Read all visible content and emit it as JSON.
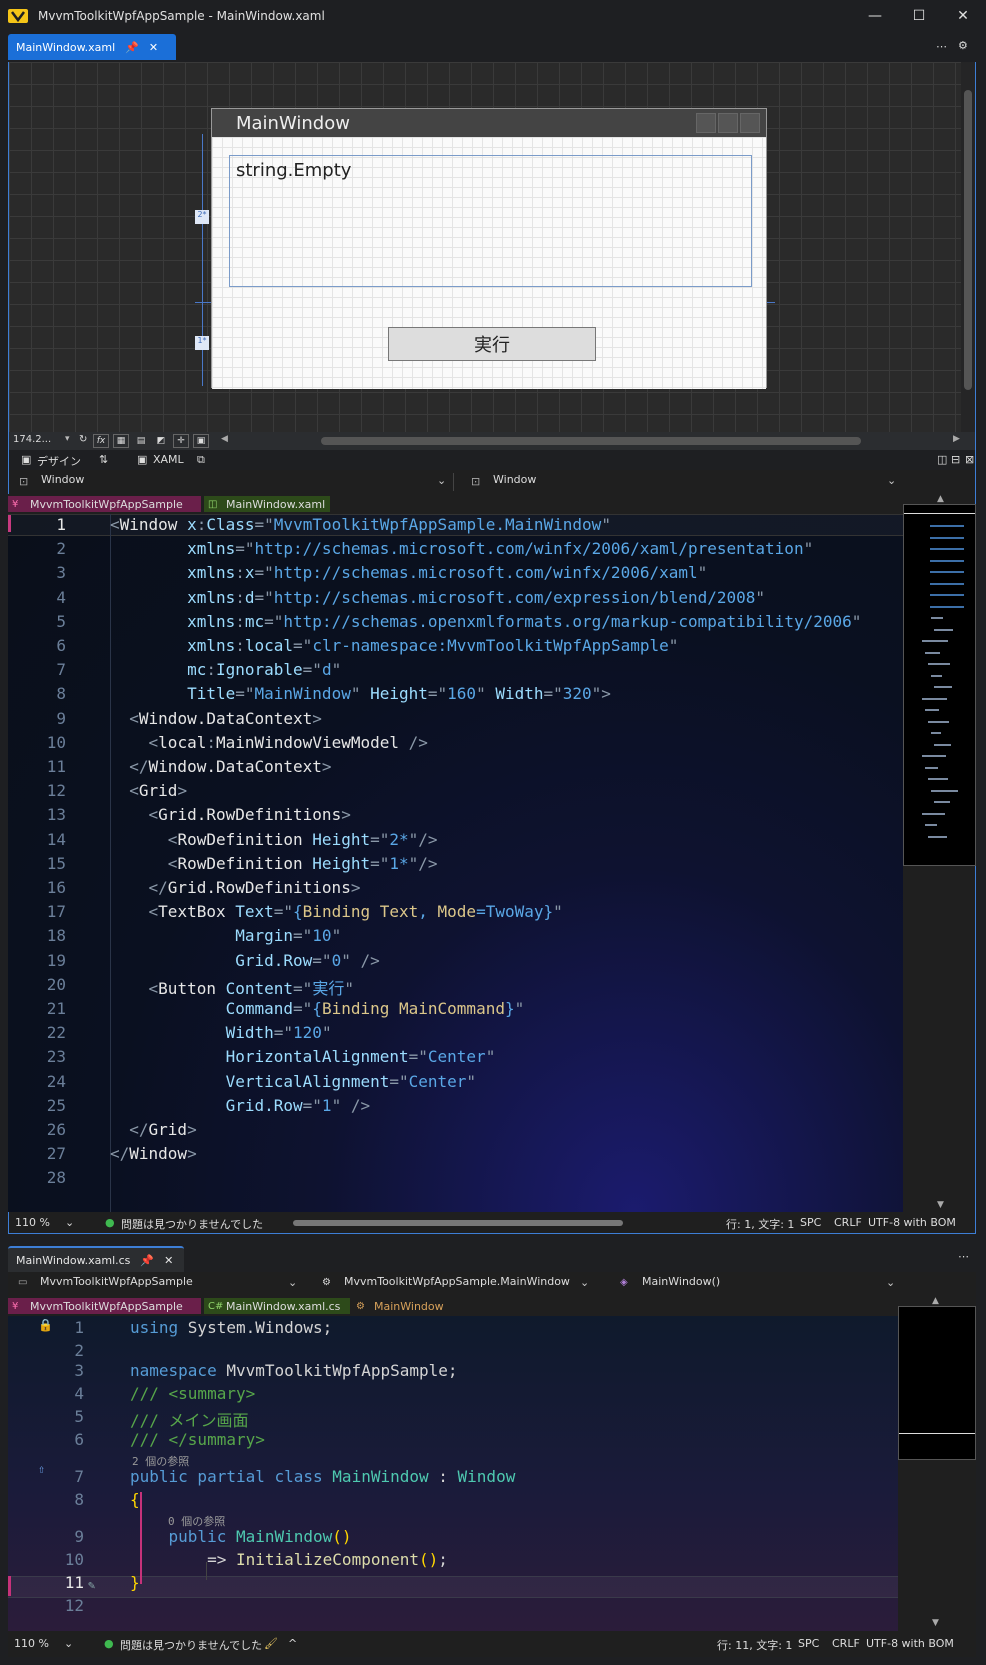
{
  "window": {
    "title": "MvvmToolkitWpfAppSample - MainWindow.xaml",
    "minimize": "—",
    "maximize": "☐",
    "close": "✕"
  },
  "tab1": {
    "label": "MainWindow.xaml",
    "pin": "📌",
    "close": "✕"
  },
  "topright": {
    "overflow": "⋯",
    "settings": "⚙"
  },
  "designer": {
    "window_title": "MainWindow",
    "textbox_text": "string.Empty",
    "button_text": "実行",
    "row_marker_1": "2*",
    "row_marker_2": "1*",
    "zoom": "174.2...",
    "fx": "fx"
  },
  "splitbar": {
    "design_label": "デザイン",
    "swap": "⇅",
    "xaml_label": "XAML"
  },
  "xaml_nav": {
    "left": "Window",
    "right": "Window"
  },
  "xaml_crumbs": {
    "project": "MvvmToolkitWpfAppSample",
    "file": "MainWindow.xaml"
  },
  "xaml_lines": [
    "1",
    "2",
    "3",
    "4",
    "5",
    "6",
    "7",
    "8",
    "9",
    "10",
    "11",
    "12",
    "13",
    "14",
    "15",
    "16",
    "17",
    "18",
    "19",
    "20",
    "21",
    "22",
    "23",
    "24",
    "25",
    "26",
    "27",
    "28"
  ],
  "xaml_code": [
    [
      [
        "t-b",
        "<"
      ],
      [
        "t-tag",
        "Window "
      ],
      [
        "t-attr",
        "x"
      ],
      [
        "t-b",
        ":"
      ],
      [
        "t-attr",
        "Class"
      ],
      [
        "t-b",
        "=\""
      ],
      [
        "t-str",
        "MvvmToolkitWpfAppSample.MainWindow"
      ],
      [
        "t-b",
        "\""
      ]
    ],
    [
      [
        "t-b",
        "        "
      ],
      [
        "t-attr",
        "xmlns"
      ],
      [
        "t-b",
        "=\""
      ],
      [
        "t-str",
        "http://schemas.microsoft.com/winfx/2006/xaml/presentation"
      ],
      [
        "t-b",
        "\""
      ]
    ],
    [
      [
        "t-b",
        "        "
      ],
      [
        "t-attr",
        "xmlns"
      ],
      [
        "t-b",
        ":"
      ],
      [
        "t-attr",
        "x"
      ],
      [
        "t-b",
        "=\""
      ],
      [
        "t-str",
        "http://schemas.microsoft.com/winfx/2006/xaml"
      ],
      [
        "t-b",
        "\""
      ]
    ],
    [
      [
        "t-b",
        "        "
      ],
      [
        "t-attr",
        "xmlns"
      ],
      [
        "t-b",
        ":"
      ],
      [
        "t-attr",
        "d"
      ],
      [
        "t-b",
        "=\""
      ],
      [
        "t-str",
        "http://schemas.microsoft.com/expression/blend/2008"
      ],
      [
        "t-b",
        "\""
      ]
    ],
    [
      [
        "t-b",
        "        "
      ],
      [
        "t-attr",
        "xmlns"
      ],
      [
        "t-b",
        ":"
      ],
      [
        "t-attr",
        "mc"
      ],
      [
        "t-b",
        "=\""
      ],
      [
        "t-str",
        "http://schemas.openxmlformats.org/markup-compatibility/2006"
      ],
      [
        "t-b",
        "\""
      ]
    ],
    [
      [
        "t-b",
        "        "
      ],
      [
        "t-attr",
        "xmlns"
      ],
      [
        "t-b",
        ":"
      ],
      [
        "t-attr",
        "local"
      ],
      [
        "t-b",
        "=\""
      ],
      [
        "t-str",
        "clr-namespace:MvvmToolkitWpfAppSample"
      ],
      [
        "t-b",
        "\""
      ]
    ],
    [
      [
        "t-b",
        "        "
      ],
      [
        "t-attr",
        "mc"
      ],
      [
        "t-b",
        ":"
      ],
      [
        "t-attr",
        "Ignorable"
      ],
      [
        "t-b",
        "=\""
      ],
      [
        "t-str",
        "d"
      ],
      [
        "t-b",
        "\""
      ]
    ],
    [
      [
        "t-b",
        "        "
      ],
      [
        "t-attr",
        "Title"
      ],
      [
        "t-b",
        "=\""
      ],
      [
        "t-str",
        "MainWindow"
      ],
      [
        "t-b",
        "\" "
      ],
      [
        "t-attr",
        "Height"
      ],
      [
        "t-b",
        "=\""
      ],
      [
        "t-str",
        "160"
      ],
      [
        "t-b",
        "\" "
      ],
      [
        "t-attr",
        "Width"
      ],
      [
        "t-b",
        "=\""
      ],
      [
        "t-str",
        "320"
      ],
      [
        "t-b",
        "\">"
      ]
    ],
    [
      [
        "t-b",
        "  <"
      ],
      [
        "t-tag",
        "Window.DataContext"
      ],
      [
        "t-b",
        ">"
      ]
    ],
    [
      [
        "t-b",
        "    <"
      ],
      [
        "t-tag",
        "local"
      ],
      [
        "t-b",
        ":"
      ],
      [
        "t-tag",
        "MainWindowViewModel "
      ],
      [
        "t-b",
        "/>"
      ]
    ],
    [
      [
        "t-b",
        "  </"
      ],
      [
        "t-tag",
        "Window.DataContext"
      ],
      [
        "t-b",
        ">"
      ]
    ],
    [
      [
        "t-b",
        "  <"
      ],
      [
        "t-tag",
        "Grid"
      ],
      [
        "t-b",
        ">"
      ]
    ],
    [
      [
        "t-b",
        "    <"
      ],
      [
        "t-tag",
        "Grid.RowDefinitions"
      ],
      [
        "t-b",
        ">"
      ]
    ],
    [
      [
        "t-b",
        "      <"
      ],
      [
        "t-tag",
        "RowDefinition "
      ],
      [
        "t-attr",
        "Height"
      ],
      [
        "t-b",
        "=\""
      ],
      [
        "t-str",
        "2*"
      ],
      [
        "t-b",
        "\"/>"
      ]
    ],
    [
      [
        "t-b",
        "      <"
      ],
      [
        "t-tag",
        "RowDefinition "
      ],
      [
        "t-attr",
        "Height"
      ],
      [
        "t-b",
        "=\""
      ],
      [
        "t-str",
        "1*"
      ],
      [
        "t-b",
        "\"/>"
      ]
    ],
    [
      [
        "t-b",
        "    </"
      ],
      [
        "t-tag",
        "Grid.RowDefinitions"
      ],
      [
        "t-b",
        ">"
      ]
    ],
    [
      [
        "t-b",
        "    <"
      ],
      [
        "t-tag",
        "TextBox "
      ],
      [
        "t-attr",
        "Text"
      ],
      [
        "t-b",
        "=\""
      ],
      [
        "t-str",
        "{"
      ],
      [
        "t-bind",
        "Binding Text"
      ],
      [
        "t-str",
        ", "
      ],
      [
        "t-bind",
        "Mode"
      ],
      [
        "t-str",
        "=TwoWay}"
      ],
      [
        "t-b",
        "\""
      ]
    ],
    [
      [
        "t-b",
        "             "
      ],
      [
        "t-attr",
        "Margin"
      ],
      [
        "t-b",
        "=\""
      ],
      [
        "t-str",
        "10"
      ],
      [
        "t-b",
        "\""
      ]
    ],
    [
      [
        "t-b",
        "             "
      ],
      [
        "t-attr",
        "Grid.Row"
      ],
      [
        "t-b",
        "=\""
      ],
      [
        "t-str",
        "0"
      ],
      [
        "t-b",
        "\" />"
      ]
    ],
    [
      [
        "t-b",
        "    <"
      ],
      [
        "t-tag",
        "Button "
      ],
      [
        "t-attr",
        "Content"
      ],
      [
        "t-b",
        "=\""
      ],
      [
        "t-str",
        "実行"
      ],
      [
        "t-b",
        "\""
      ]
    ],
    [
      [
        "t-b",
        "            "
      ],
      [
        "t-attr",
        "Command"
      ],
      [
        "t-b",
        "=\""
      ],
      [
        "t-str",
        "{"
      ],
      [
        "t-bind",
        "Binding MainCommand"
      ],
      [
        "t-str",
        "}"
      ],
      [
        "t-b",
        "\""
      ]
    ],
    [
      [
        "t-b",
        "            "
      ],
      [
        "t-attr",
        "Width"
      ],
      [
        "t-b",
        "=\""
      ],
      [
        "t-str",
        "120"
      ],
      [
        "t-b",
        "\""
      ]
    ],
    [
      [
        "t-b",
        "            "
      ],
      [
        "t-attr",
        "HorizontalAlignment"
      ],
      [
        "t-b",
        "=\""
      ],
      [
        "t-str",
        "Center"
      ],
      [
        "t-b",
        "\""
      ]
    ],
    [
      [
        "t-b",
        "            "
      ],
      [
        "t-attr",
        "VerticalAlignment"
      ],
      [
        "t-b",
        "=\""
      ],
      [
        "t-str",
        "Center"
      ],
      [
        "t-b",
        "\""
      ]
    ],
    [
      [
        "t-b",
        "            "
      ],
      [
        "t-attr",
        "Grid.Row"
      ],
      [
        "t-b",
        "=\""
      ],
      [
        "t-str",
        "1"
      ],
      [
        "t-b",
        "\" />"
      ]
    ],
    [
      [
        "t-b",
        "  </"
      ],
      [
        "t-tag",
        "Grid"
      ],
      [
        "t-b",
        ">"
      ]
    ],
    [
      [
        "t-b",
        "</"
      ],
      [
        "t-tag",
        "Window"
      ],
      [
        "t-b",
        ">"
      ]
    ],
    []
  ],
  "xaml_status": {
    "zoom": "110 %",
    "issues": "問題は見つかりませんでした",
    "position": "行: 1, 文字: 1",
    "spc": "SPC",
    "crlf": "CRLF",
    "encoding": "UTF-8 with BOM"
  },
  "tab2": {
    "label": "MainWindow.xaml.cs",
    "pin": "📌",
    "close": "✕",
    "overflow": "⋯"
  },
  "cs_nav": {
    "project": "MvvmToolkitWpfAppSample",
    "class": "MvvmToolkitWpfAppSample.MainWindow",
    "member": "MainWindow()"
  },
  "cs_crumbs": {
    "project": "MvvmToolkitWpfAppSample",
    "file": "MainWindow.xaml.cs",
    "class": "MainWindow"
  },
  "cs_code": [
    {
      "n": "1",
      "parts": [
        [
          "c-kw",
          "using "
        ],
        [
          "c-p",
          "System.Windows;"
        ]
      ]
    },
    {
      "n": "2",
      "parts": []
    },
    {
      "n": "3",
      "parts": [
        [
          "c-kw",
          "namespace "
        ],
        [
          "c-p",
          "MvvmToolkitWpfAppSample;"
        ]
      ]
    },
    {
      "n": "4",
      "parts": [
        [
          "c-cm",
          "/// <summary>"
        ]
      ]
    },
    {
      "n": "5",
      "parts": [
        [
          "c-cm",
          "/// メイン画面"
        ]
      ]
    },
    {
      "n": "6",
      "parts": [
        [
          "c-cm",
          "/// </summary>"
        ]
      ]
    },
    {
      "hint": "2 個の参照",
      "indent": ""
    },
    {
      "n": "7",
      "parts": [
        [
          "c-kw",
          "public partial class "
        ],
        [
          "c-cls",
          "MainWindow"
        ],
        [
          "c-p",
          " : "
        ],
        [
          "c-cls",
          "Window"
        ]
      ]
    },
    {
      "n": "8",
      "parts": [
        [
          "c-br",
          "{"
        ]
      ]
    },
    {
      "hint": "0 個の参照",
      "indent": "    "
    },
    {
      "n": "9",
      "parts": [
        [
          "c-p",
          "    "
        ],
        [
          "c-kw",
          "public "
        ],
        [
          "c-cls",
          "MainWindow"
        ],
        [
          "c-br",
          "()"
        ]
      ]
    },
    {
      "n": "10",
      "parts": [
        [
          "c-p",
          "        => "
        ],
        [
          "c-fn",
          "InitializeComponent"
        ],
        [
          "c-br",
          "()"
        ],
        [
          "c-p",
          ";"
        ]
      ]
    },
    {
      "n": "11",
      "parts": [
        [
          "c-br",
          "}"
        ]
      ]
    },
    {
      "n": "12",
      "parts": []
    }
  ],
  "cs_status": {
    "zoom": "110 %",
    "issues": "問題は見つかりませんでした",
    "position": "行: 11, 文字: 1",
    "spc": "SPC",
    "crlf": "CRLF",
    "encoding": "UTF-8 with BOM"
  },
  "colors": {
    "accent": "#3d7ed6",
    "tab_active": "#1b6fd8",
    "project_badge": "#c6327a"
  }
}
